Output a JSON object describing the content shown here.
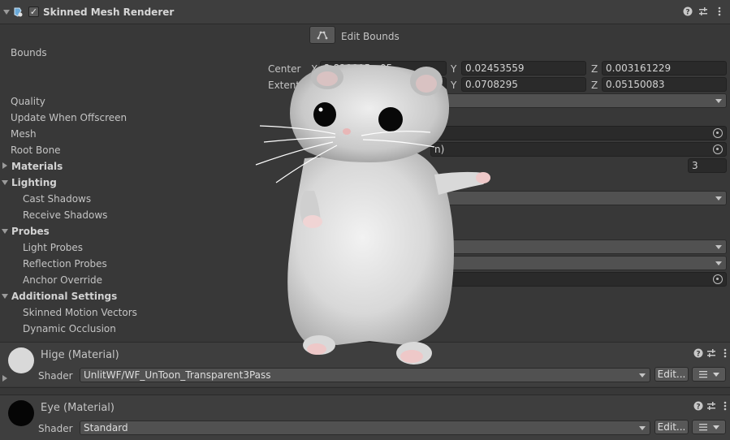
{
  "component": {
    "title": "Skinned Mesh Renderer",
    "enabled_check": "✓",
    "edit_bounds_label": "Edit Bounds"
  },
  "bounds": {
    "label": "Bounds",
    "center": {
      "label": "Center",
      "x_label": "X",
      "x": "2.828895e-05",
      "y_label": "Y",
      "y": "0.02453559",
      "z_label": "Z",
      "z": "0.003161229"
    },
    "extent": {
      "label": "Extent",
      "x_label": "X",
      "x": "",
      "y_label": "Y",
      "y": "0.0708295",
      "z_label": "Z",
      "z": "0.05150083"
    }
  },
  "properties": {
    "quality": "Quality",
    "update_offscreen": "Update When Offscreen",
    "mesh": "Mesh",
    "root_bone": "Root Bone",
    "root_bone_value": "n)",
    "materials": "Materials",
    "materials_count": "3",
    "lighting": "Lighting",
    "cast_shadows": "Cast Shadows",
    "receive_shadows": "Receive Shadows",
    "probes": "Probes",
    "light_probes": "Light Probes",
    "reflection_probes": "Reflection Probes",
    "anchor_override": "Anchor Override",
    "additional_settings": "Additional Settings",
    "skinned_motion_vectors": "Skinned Motion Vectors",
    "dynamic_occlusion": "Dynamic Occlusion"
  },
  "materials_list": [
    {
      "name": "Hige (Material)",
      "shader_label": "Shader",
      "shader": "UnlitWF/WF_UnToon_Transparent3Pass",
      "edit": "Edit...",
      "swatch_color": "#d9d9d9"
    },
    {
      "name": "Eye (Material)",
      "shader_label": "Shader",
      "shader": "Standard",
      "edit": "Edit...",
      "swatch_color": "#050505"
    }
  ],
  "icons": [
    "help-icon",
    "presets-icon",
    "more-icon",
    "skinned-mesh-renderer-icon",
    "edit-bounds-icon",
    "object-picker-icon",
    "list-icon"
  ]
}
